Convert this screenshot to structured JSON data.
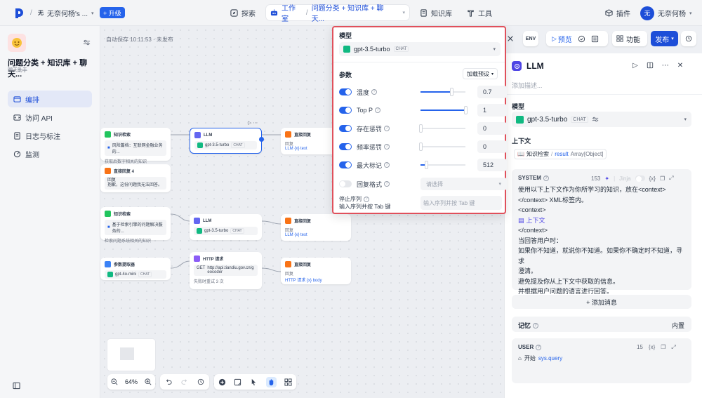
{
  "topbar": {
    "avatar_letter": "无",
    "workspace": "无奈何杨's ...",
    "upgrade": "+ 升级",
    "explore": "探索",
    "studio": "工作室",
    "current_app": "问题分类 + 知识库 + 聊天...",
    "knowledge": "知识库",
    "tools": "工具",
    "plugins": "插件",
    "user_avatar": "无",
    "user_name": "无奈何杨"
  },
  "sidebar": {
    "app_title": "问题分类 + 知识库 + 聊天...",
    "app_type": "聊天助手",
    "items": [
      {
        "label": "编排"
      },
      {
        "label": "访问 API"
      },
      {
        "label": "日志与标注"
      },
      {
        "label": "监测"
      }
    ]
  },
  "canvas": {
    "autosave": "自动保存 10:11:53 · 未发布",
    "zoom": "64%",
    "nodes": {
      "kr1_title": "知识检索",
      "kr1_sub": "风险篇档：互联网金融业务的...",
      "kr1_note": "获取后数字相关的知识",
      "dr4_title": "直接回复 4",
      "dr4_l1": "回复",
      "dr4_l2": "抱歉，这份问题我无法回答。",
      "llm1_title": "LLM",
      "llm1_model": "gpt-3.5-turbo",
      "llm1_chip": "CHAT",
      "dr1_title": "直接回复",
      "dr1_l1": "回复",
      "dr1_var": "LLM  {x} text",
      "kr2_title": "知识检索",
      "kr2_sub": "基于检索引擎的问题解决服务的...",
      "kr2_note": "检索问题系统相关的知识",
      "llm2_title": "LLM",
      "llm2_model": "gpt-3.5-turbo",
      "llm2_chip": "CHAT",
      "dr2_title": "直接回复",
      "dr2_l1": "回复",
      "dr2_var": "LLM  {x} text",
      "pe_title": "参数提取器",
      "pe_model": "gpt-4o-mini",
      "pe_chip": "CHAT",
      "http_title": "HTTP 请求",
      "http_method": "GET",
      "http_url": "http://api.tiandiu.gov.cn/geocoder",
      "http_note": "失败时重试 3 次",
      "dr3_title": "直接回复",
      "dr3_l1": "回复",
      "dr3_var": "HTTP 请求  {x} body"
    }
  },
  "popup": {
    "model_label": "模型",
    "model_name": "gpt-3.5-turbo",
    "model_chip": "CHAT",
    "params_label": "参数",
    "preset_label": "加载预设",
    "params": [
      {
        "label": "温度",
        "value": "0.7",
        "level": 0.7,
        "enabled": true
      },
      {
        "label": "Top P",
        "value": "1",
        "level": 1.0,
        "enabled": true
      },
      {
        "label": "存在惩罚",
        "value": "0",
        "level": 0.0,
        "enabled": true
      },
      {
        "label": "频率惩罚",
        "value": "0",
        "level": 0.0,
        "enabled": true
      },
      {
        "label": "最大标记",
        "value": "512",
        "level": 0.125,
        "enabled": true
      }
    ],
    "response_format_label": "回复格式",
    "response_format_placeholder": "请选择",
    "stop_label": "停止序列",
    "stop_hint": "输入序列并按 Tab 键",
    "stop_placeholder": "输入序列并按 Tab 键"
  },
  "header_actions": {
    "preview": "预览",
    "features": "功能",
    "publish": "发布"
  },
  "panel": {
    "title": "LLM",
    "desc_placeholder": "添加描述...",
    "model_label": "模型",
    "model_name": "gpt-3.5-turbo",
    "model_chip": "CHAT",
    "context_label": "上下文",
    "context_source": "知识检索",
    "context_sep": "/",
    "context_var": "result",
    "context_type": "Array[Object]",
    "system_label": "SYSTEM",
    "system_tokens": "153",
    "jinja_label": "Jinja",
    "system_lines": [
      "使用以下上下文作为你所学习的知识，放在<context>",
      "</context> XML标签内。",
      "<context>",
      "",
      "</context>",
      "当回答用户时：",
      "如果你不知道，就说你不知道。如果你不确定时不知道，寻求",
      "澄清。",
      "避免提及你从上下文中获取的信息。",
      "并根据用户问题的语言进行回答。"
    ],
    "context_block": "上下文",
    "add_message": "+ 添加消息",
    "memory_label": "记忆",
    "memory_value": "内置",
    "user_label": "USER",
    "user_tokens": "15",
    "user_start": "开始",
    "user_var": "sys.query"
  },
  "colors": {
    "accent": "#2563eb",
    "highlight_border": "#e0505b",
    "gpt_green": "#10b981"
  }
}
